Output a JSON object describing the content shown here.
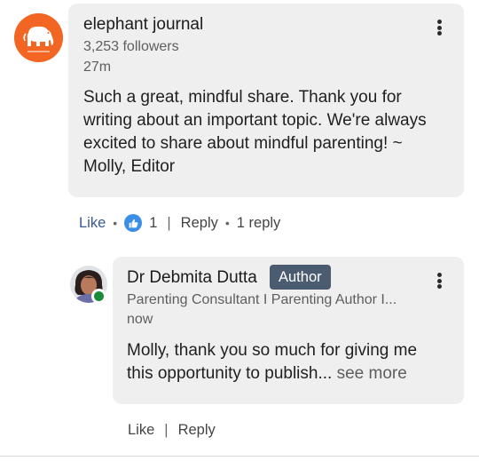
{
  "comment": {
    "author": "elephant journal",
    "followers": "3,253 followers",
    "time": "27m",
    "text_lines": [
      "Such a great, mindful share. Thank you for",
      "writing about an important topic. We're always",
      "excited to share about mindful parenting! ~",
      "Molly, Editor"
    ],
    "actions": {
      "like": "Like",
      "reaction_count": "1",
      "reply": "Reply",
      "replies": "1 reply"
    }
  },
  "reply": {
    "author": "Dr Debmita Dutta",
    "badge": "Author",
    "headline": "Parenting Consultant I Parenting Author I...",
    "time": "now",
    "text_lines": [
      "Molly, thank you so much for giving me",
      "this opportunity to publish..."
    ],
    "see_more": "see more",
    "actions": {
      "like": "Like",
      "reply": "Reply"
    }
  },
  "colors": {
    "brand_orange": "#f26522",
    "like_blue": "#3a5a94",
    "badge_bg": "#4b5c70",
    "online_green": "#1a8b3a"
  }
}
